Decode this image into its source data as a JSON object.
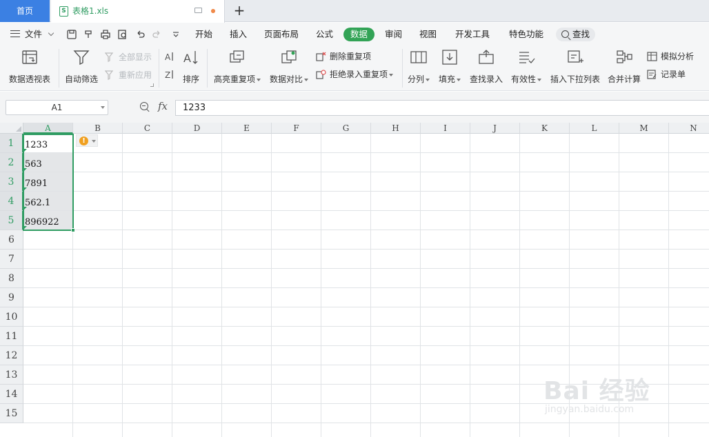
{
  "tabbar": {
    "home_label": "首页",
    "file_name": "表格1.xls",
    "file_icon_letter": "S",
    "add_label": "+"
  },
  "menubar": {
    "file_label": "文件",
    "tabs": [
      "开始",
      "插入",
      "页面布局",
      "公式",
      "数据",
      "审阅",
      "视图",
      "开发工具",
      "特色功能"
    ],
    "active_tab": "数据",
    "search_label": "查找"
  },
  "ribbon": {
    "pivot": "数据透视表",
    "autofilter": "自动筛选",
    "show_all": "全部显示",
    "reapply": "重新应用",
    "sort": "排序",
    "highlight_dup": "高亮重复项",
    "compare": "数据对比",
    "delete_dup": "删除重复项",
    "reject_dup": "拒绝录入重复项",
    "split": "分列",
    "fill": "填充",
    "lookup_entry": "查找录入",
    "validity": "有效性",
    "insert_dropdown": "插入下拉列表",
    "consolidate": "合并计算",
    "whatif": "模拟分析",
    "record": "记录单"
  },
  "formulabar": {
    "name_box": "A1",
    "fx_label": "fx",
    "formula": "1233"
  },
  "grid": {
    "columns": [
      "A",
      "B",
      "C",
      "D",
      "E",
      "F",
      "G",
      "H",
      "I",
      "J",
      "K",
      "L",
      "M",
      "N"
    ],
    "rows": [
      "1",
      "2",
      "3",
      "4",
      "5",
      "6",
      "7",
      "8",
      "9",
      "10",
      "11",
      "12",
      "13",
      "14",
      "15"
    ],
    "selected_column": "A",
    "cells_A": [
      "1233",
      "563",
      "7891",
      "562.1",
      "896922"
    ],
    "warn_symbol": "!"
  },
  "watermark": {
    "text": "Bai 经验",
    "url": "jingyan.baidu.com"
  },
  "colors": {
    "accent_green": "#2f9c62",
    "home_tab_blue": "#3b80e3",
    "warning_orange": "#f0a020"
  }
}
